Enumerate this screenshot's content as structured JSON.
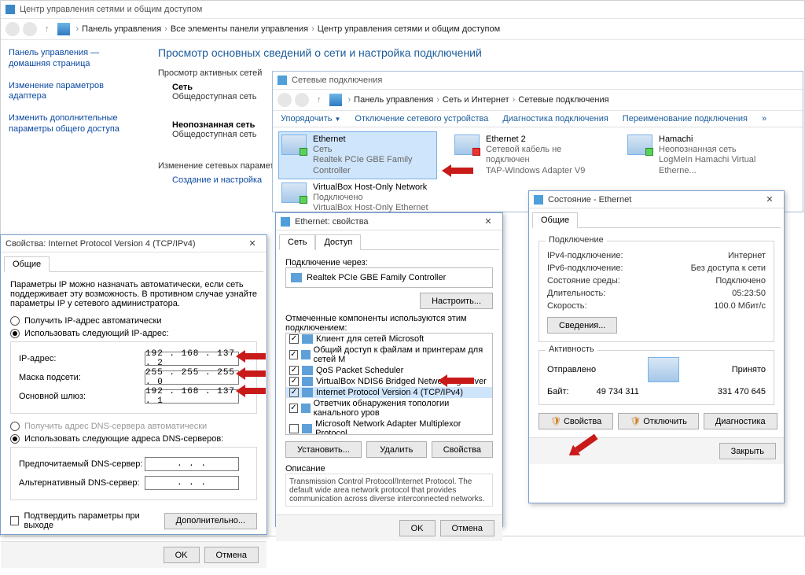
{
  "mainWindow": {
    "title": "Центр управления сетями и общим доступом",
    "breadcrumb": [
      "Панель управления",
      "Все элементы панели управления",
      "Центр управления сетями и общим доступом"
    ],
    "leftLinks": [
      "Панель управления — домашняя страница",
      "Изменение параметров адаптера",
      "Изменить дополнительные параметры общего доступа"
    ],
    "heading": "Просмотр основных сведений о сети и настройка подключений",
    "activeLabel": "Просмотр активных сетей",
    "net1_name": "Сеть",
    "net1_sub": "Общедоступная сеть",
    "net2_name": "Неопознанная сеть",
    "net2_sub": "Общедоступная сеть",
    "changeLabel": "Изменение сетевых параметров",
    "createLink": "Создание и настройка"
  },
  "ncWindow": {
    "title": "Сетевые подключения",
    "breadcrumb": [
      "Панель управления",
      "Сеть и Интернет",
      "Сетевые подключения"
    ],
    "toolbar": {
      "organize": "Упорядочить",
      "disable": "Отключение сетевого устройства",
      "diag": "Диагностика подключения",
      "rename": "Переименование подключения"
    },
    "items": [
      {
        "name": "Ethernet",
        "line2": "Сеть",
        "line3": "Realtek PCIe GBE Family Controller",
        "state": "ok",
        "sel": true
      },
      {
        "name": "Ethernet 2",
        "line2": "Сетевой кабель не подключен",
        "line3": "TAP-Windows Adapter V9",
        "state": "red"
      },
      {
        "name": "Hamachi",
        "line2": "Неопознанная сеть",
        "line3": "LogMeIn Hamachi Virtual Etherne...",
        "state": "ok"
      },
      {
        "name": "VirtualBox Host-Only Network",
        "line2": "Подключено",
        "line3": "VirtualBox Host-Only Ethernet Ad...",
        "state": "ok"
      }
    ]
  },
  "ethProp": {
    "title": "Ethernet: свойства",
    "tabs": [
      "Сеть",
      "Доступ"
    ],
    "connLabel": "Подключение через:",
    "adapter": "Realtek PCIe GBE Family Controller",
    "configureBtn": "Настроить...",
    "compLabel": "Отмеченные компоненты используются этим подключением:",
    "components": [
      {
        "checked": true,
        "label": "Клиент для сетей Microsoft",
        "sel": false
      },
      {
        "checked": true,
        "label": "Общий доступ к файлам и принтерам для сетей M",
        "sel": false
      },
      {
        "checked": true,
        "label": "QoS Packet Scheduler",
        "sel": false
      },
      {
        "checked": true,
        "label": "VirtualBox NDIS6 Bridged Networking Driver",
        "sel": false
      },
      {
        "checked": true,
        "label": "Internet Protocol Version 4 (TCP/IPv4)",
        "sel": true
      },
      {
        "checked": true,
        "label": "Ответчик обнаружения топологии канального уров",
        "sel": false
      },
      {
        "checked": false,
        "label": "Microsoft Network Adapter Multiplexor Protocol",
        "sel": false
      }
    ],
    "installBtn": "Установить...",
    "removeBtn": "Удалить",
    "propsBtn": "Свойства",
    "descLabel": "Описание",
    "desc": "Transmission Control Protocol/Internet Protocol. The default wide area network protocol that provides communication across diverse interconnected networks.",
    "ok": "OK",
    "cancel": "Отмена"
  },
  "status": {
    "title": "Состояние - Ethernet",
    "tab": "Общие",
    "connGroup": "Подключение",
    "rows": [
      {
        "k": "IPv4-подключение:",
        "v": "Интернет"
      },
      {
        "k": "IPv6-подключение:",
        "v": "Без доступа к сети"
      },
      {
        "k": "Состояние среды:",
        "v": "Подключено"
      },
      {
        "k": "Длительность:",
        "v": "05:23:50"
      },
      {
        "k": "Скорость:",
        "v": "100.0 Мбит/с"
      }
    ],
    "detailsBtn": "Сведения...",
    "activityGroup": "Активность",
    "sent": "Отправлено",
    "recv": "Принято",
    "bytesLabel": "Байт:",
    "bytesSent": "49 734 311",
    "bytesRecv": "331 470 645",
    "propsBtn": "Свойства",
    "disableBtn": "Отключить",
    "diagBtn": "Диагностика",
    "closeBtn": "Закрыть"
  },
  "ipv4": {
    "title": "Свойства: Internet Protocol Version 4 (TCP/IPv4)",
    "tab": "Общие",
    "intro": "Параметры IP можно назначать автоматически, если сеть поддерживает эту возможность. В противном случае узнайте параметры IP у сетевого администратора.",
    "radioAuto": "Получить IP-адрес автоматически",
    "radioManual": "Использовать следующий IP-адрес:",
    "ipLabel": "IP-адрес:",
    "ipVal": "192 . 168 . 137 .  2",
    "maskLabel": "Маска подсети:",
    "maskVal": "255 . 255 . 255 .  0",
    "gwLabel": "Основной шлюз:",
    "gwVal": "192 . 168 . 137 .  1",
    "dnsAuto": "Получить адрес DNS-сервера автоматически",
    "dnsManual": "Использовать следующие адреса DNS-серверов:",
    "dns1Label": "Предпочитаемый DNS-сервер:",
    "dns1Val": " .   .   . ",
    "dns2Label": "Альтернативный DNS-сервер:",
    "dns2Val": " .   .   . ",
    "confirmExit": "Подтвердить параметры при выходе",
    "advBtn": "Дополнительно...",
    "ok": "OK",
    "cancel": "Отмена"
  }
}
